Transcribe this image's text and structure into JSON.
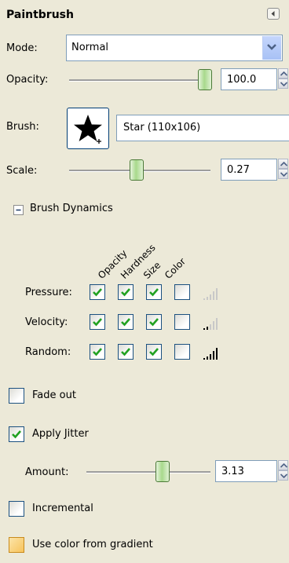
{
  "panel": {
    "title": "Paintbrush",
    "mode_label": "Mode:",
    "mode_value": "Normal",
    "opacity_label": "Opacity:",
    "opacity_value": "100.0",
    "opacity_level": 1.0,
    "brush_label": "Brush:",
    "brush_name": "Star (110x106)",
    "scale_label": "Scale:",
    "scale_value": "0.27",
    "dynamics": {
      "header": "Brush Dynamics",
      "columns": [
        "Opacity",
        "Hardness",
        "Size",
        "Color"
      ],
      "rows": [
        {
          "label": "Pressure:",
          "checks": [
            true,
            true,
            true,
            false
          ]
        },
        {
          "label": "Velocity:",
          "checks": [
            true,
            true,
            true,
            false
          ]
        },
        {
          "label": "Random:",
          "checks": [
            true,
            true,
            true,
            false
          ]
        }
      ]
    },
    "fade_out_label": "Fade out",
    "fade_out_checked": false,
    "apply_jitter_label": "Apply Jitter",
    "apply_jitter_checked": true,
    "amount_label": "Amount:",
    "amount_value": "3.13",
    "incremental_label": "Incremental",
    "incremental_checked": false,
    "gradient_label": "Use color from gradient",
    "gradient_checked": false
  },
  "colors": {
    "background": "#ece9d8",
    "check_green": "#21a121",
    "checkbox_border": "#1c5180",
    "slider_thumb": "#a8d98c"
  }
}
